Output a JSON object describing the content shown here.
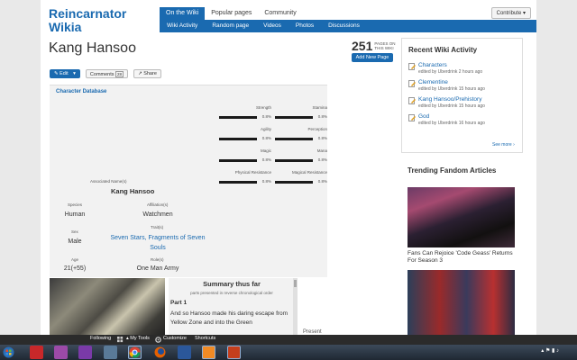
{
  "header": {
    "wiki_name": "Reincarnator Wikia",
    "top_tabs": [
      "On the Wiki",
      "Popular pages",
      "Community"
    ],
    "sub_nav": [
      "Wiki Activity",
      "Random page",
      "Videos",
      "Photos",
      "Discussions"
    ],
    "contribute": "Contribute ▾"
  },
  "page": {
    "title": "Kang Hansoo",
    "pages_count": "251",
    "pages_label": "PAGES ON THIS WIKI",
    "add_new_page": "Add New Page",
    "edit": "✎ Edit",
    "edit_caret": "▾",
    "comments": "Comments",
    "comments_count": "28",
    "share": "↗ Share"
  },
  "character_db": {
    "title": "Character Database",
    "stats": [
      {
        "label": "Strength",
        "value": "0.8%"
      },
      {
        "label": "Stamina",
        "value": "0.8%"
      },
      {
        "label": "Agility",
        "value": "0.8%"
      },
      {
        "label": "Perception",
        "value": "0.8%"
      },
      {
        "label": "Magic",
        "value": "0.8%"
      },
      {
        "label": "Mana",
        "value": "0.8%"
      },
      {
        "label": "Physical Resistance",
        "value": "0.8%"
      },
      {
        "label": "Magical Resistance",
        "value": "0.8%"
      }
    ],
    "associated_label": "Associated Name(s)",
    "name": "Kang Hansoo",
    "species_label": "Species",
    "species": "Human",
    "affiliation_label": "Affiliation(s)",
    "affiliation": "Watchmen",
    "sex_label": "Sex",
    "sex": "Male",
    "traits_label": "Trait(s)",
    "traits": "Seven Stars, Fragments of Seven Souls",
    "age_label": "Age",
    "age": "21(+55)",
    "roles_label": "Role(s)",
    "roles": "One Man Army"
  },
  "summary": {
    "title": "Summary thus far",
    "subtitle": "parts presented in reverse chronological order",
    "part": "Part 1",
    "text": "And so Hansoo made his daring escape from Yellow Zone and into the Green",
    "present": "Present"
  },
  "recent_activity": {
    "title": "Recent Wiki Activity",
    "items": [
      {
        "name": "Characters",
        "meta": "edited by Uberdrink 2 hours ago"
      },
      {
        "name": "Clementine",
        "meta": "edited by Uberdrink 15 hours ago"
      },
      {
        "name": "Kang Hansoo/Prehistory",
        "meta": "edited by Uberdrink 15 hours ago"
      },
      {
        "name": "God",
        "meta": "edited by Uberdrink 16 hours ago"
      }
    ],
    "see_more": "See more ›"
  },
  "trending": {
    "title": "Trending Fandom Articles",
    "caption": "Fans Can Rejoice 'Code Geass' Returns For Season 3"
  },
  "toolbar": {
    "following": "Following",
    "my_tools": "▴ My Tools",
    "customize": "Customize",
    "shortcuts": "Shortcuts"
  },
  "taskbar": {
    "clock": "▴ ⚑ ▮ ♪"
  }
}
